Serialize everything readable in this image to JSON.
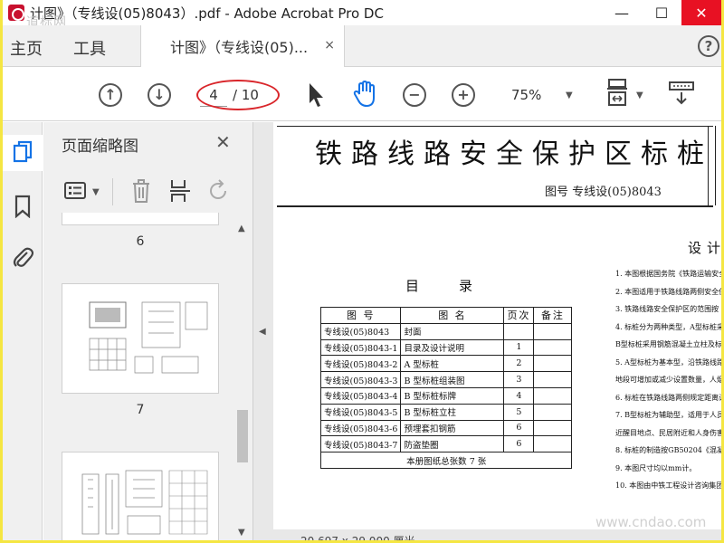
{
  "window": {
    "title": "计图》（专线设(05)8043）.pdf - Adobe Acrobat Pro DC",
    "watermark_top": "道标网",
    "minimize_glyph": "—",
    "maximize_glyph": "☐",
    "close_glyph": "✕"
  },
  "tabs": {
    "home": "主页",
    "tools": "工具",
    "doc_tab": "计图》（专线设(05)...",
    "close_glyph": "×",
    "help_glyph": "?"
  },
  "toolbar": {
    "prev_glyph": "↑",
    "next_glyph": "↓",
    "page_current": "4",
    "page_total": "/ 10",
    "zoom_out_glyph": "−",
    "zoom_in_glyph": "+",
    "zoom_value": "75%"
  },
  "thumbnails": {
    "title": "页面缩略图",
    "close_glyph": "✕",
    "pages": [
      "6",
      "7"
    ]
  },
  "document": {
    "title": "铁路线路安全保护区标桩",
    "subtitle": "图号  专线设(05)8043",
    "toc_heading": "目录",
    "design_heading": "设计",
    "toc_headers": [
      "图 号",
      "图 名",
      "页次",
      "备注"
    ],
    "toc_rows": [
      [
        "专线设(05)8043",
        "封面",
        "",
        ""
      ],
      [
        "专线设(05)8043-1",
        "目录及设计说明",
        "1",
        ""
      ],
      [
        "专线设(05)8043-2",
        "A 型标桩",
        "2",
        ""
      ],
      [
        "专线设(05)8043-3",
        "B 型标桩组装图",
        "3",
        ""
      ],
      [
        "专线设(05)8043-4",
        "B 型标桩标牌",
        "4",
        ""
      ],
      [
        "专线设(05)8043-5",
        "B 型标桩立柱",
        "5",
        ""
      ],
      [
        "专线设(05)8043-6",
        "预埋套扣钢筋",
        "6",
        ""
      ],
      [
        "专线设(05)8043-7",
        "防盗垫圈",
        "6",
        ""
      ]
    ],
    "toc_footer": "本册图纸总张数 7 张",
    "notes": [
      "1. 本图根据国务院《铁路运输安全保",
      "2. 本图适用于铁路线路两侧安全保护",
      "3. 铁路线路安全保护区的范围按《铁",
      "4. 标桩分为两种类型，A型标桩采用",
      "   B型标桩采用钢筋混凝土立柱及标",
      "5. A型标桩为基本型，沿铁路线路安",
      "   地段可增加或减少设置数量，人烟",
      "6. 标桩在铁路线路两侧规定距离设",
      "7. B型标桩为辅助型，适用于人员活",
      "   近醒目地点、民居附近和人身伤害",
      "8. 标桩的制造按GB50204《混凝土结",
      "9. 本图尺寸均以mm计。",
      "10. 本图由中铁工程设计咨询集团有"
    ],
    "coord_text": "20.697 x 29.000 厘米",
    "watermark_bottom": "www.cndao.com"
  }
}
